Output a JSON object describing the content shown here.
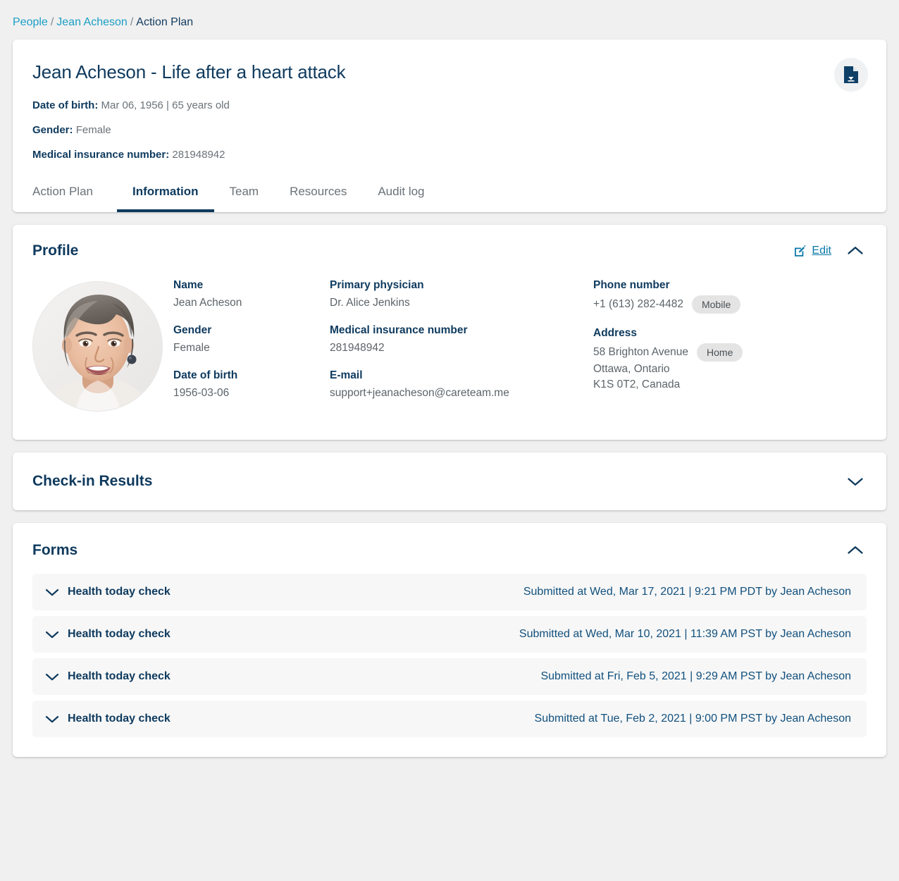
{
  "breadcrumb": {
    "items": [
      {
        "label": "People",
        "link": true
      },
      {
        "label": "Jean Acheson",
        "link": true
      },
      {
        "label": "Action Plan",
        "link": false
      }
    ],
    "separator": "/"
  },
  "header": {
    "title": "Jean Acheson - Life after a heart attack",
    "meta": [
      {
        "label": "Date of birth:",
        "value": "Mar 06, 1956 | 65 years old"
      },
      {
        "label": "Gender:",
        "value": "Female"
      },
      {
        "label": "Medical insurance number:",
        "value": "281948942"
      }
    ],
    "download_icon": "document-download-icon"
  },
  "tabs": [
    {
      "label": "Action Plan",
      "active": false
    },
    {
      "label": "Information",
      "active": true
    },
    {
      "label": "Team",
      "active": false
    },
    {
      "label": "Resources",
      "active": false
    },
    {
      "label": "Audit log",
      "active": false
    }
  ],
  "profile": {
    "title": "Profile",
    "edit_label": "Edit",
    "edit_icon": "pencil-square-icon",
    "collapse_icon": "chevron-up-icon",
    "expanded": true,
    "avatar_alt": "Jean Acheson portrait",
    "columns": [
      {
        "fields": [
          {
            "label": "Name",
            "value": "Jean Acheson"
          },
          {
            "label": "Gender",
            "value": "Female"
          },
          {
            "label": "Date of birth",
            "value": "1956-03-06"
          }
        ]
      },
      {
        "fields": [
          {
            "label": "Primary physician",
            "value": "Dr. Alice Jenkins"
          },
          {
            "label": "Medical insurance number",
            "value": "281948942"
          },
          {
            "label": "E-mail",
            "value": "support+jeanacheson@careteam.me"
          }
        ]
      },
      {
        "fields": [
          {
            "label": "Phone number",
            "value": "+1 (613) 282-4482",
            "badge": "Mobile"
          },
          {
            "label": "Address",
            "value": "58 Brighton Avenue",
            "badge": "Home",
            "extra_lines": [
              "Ottawa, Ontario",
              "K1S 0T2, Canada"
            ]
          }
        ]
      }
    ]
  },
  "checkin": {
    "title": "Check-in Results",
    "collapse_icon": "chevron-down-icon",
    "expanded": false
  },
  "forms": {
    "title": "Forms",
    "collapse_icon": "chevron-up-icon",
    "expanded": true,
    "rows": [
      {
        "name": "Health today check",
        "status": "Submitted at Wed, Mar 17, 2021 | 9:21 PM PDT by Jean Acheson",
        "icon": "chevron-down-icon"
      },
      {
        "name": "Health today check",
        "status": "Submitted at Wed, Mar 10, 2021 | 11:39 AM PST by Jean Acheson",
        "icon": "chevron-down-icon"
      },
      {
        "name": "Health today check",
        "status": "Submitted at Fri, Feb 5, 2021 | 9:29 AM PST by Jean Acheson",
        "icon": "chevron-down-icon"
      },
      {
        "name": "Health today check",
        "status": "Submitted at Tue, Feb 2, 2021 | 9:00 PM PST by Jean Acheson",
        "icon": "chevron-down-icon"
      }
    ]
  },
  "colors": {
    "navy": "#0e3a5e",
    "link_teal": "#1a9ec4",
    "link_blue": "#0a78a8",
    "status_blue": "#11507d",
    "page_bg": "#f0f0f0",
    "row_bg": "#f7f7f7",
    "pill_bg": "#e4e4e4"
  }
}
